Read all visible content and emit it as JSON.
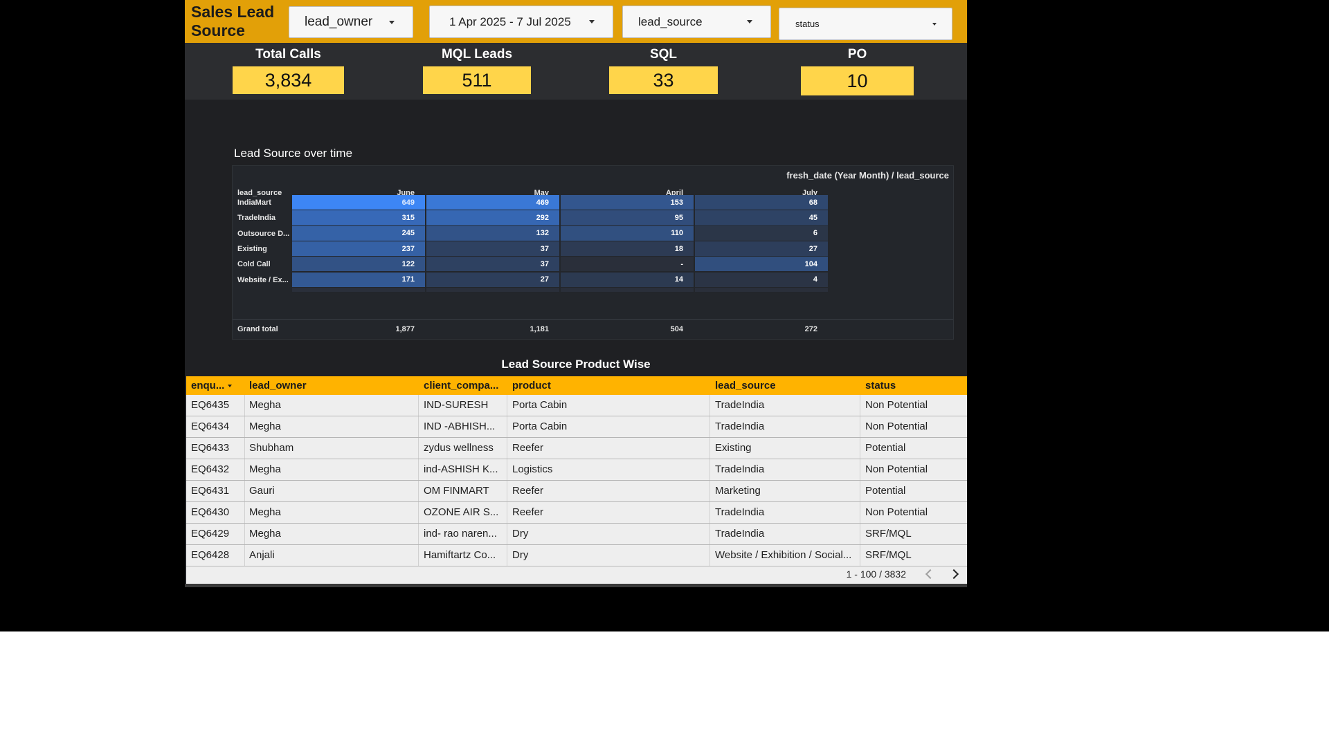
{
  "header": {
    "title": "Sales Lead Source",
    "filters": {
      "lead_owner": "lead_owner",
      "date_range": "1 Apr 2025 - 7 Jul 2025",
      "lead_source": "lead_source",
      "status": "status"
    }
  },
  "kpis": [
    {
      "label": "Total Calls",
      "value": "3,834"
    },
    {
      "label": "MQL Leads",
      "value": "511"
    },
    {
      "label": "SQL",
      "value": "33"
    },
    {
      "label": "PO",
      "value": "10"
    }
  ],
  "pivot": {
    "title": "Lead Source over time",
    "dimension_label": "fresh_date (Year Month) / lead_source",
    "row_header": "lead_source",
    "columns": [
      "June",
      "May",
      "April",
      "July"
    ],
    "rows": [
      {
        "label": "IndiaMart",
        "values": [
          "649",
          "469",
          "153",
          "68"
        ]
      },
      {
        "label": "TradeIndia",
        "values": [
          "315",
          "292",
          "95",
          "45"
        ]
      },
      {
        "label": "Outsource D...",
        "values": [
          "245",
          "132",
          "110",
          "6"
        ]
      },
      {
        "label": "Existing",
        "values": [
          "237",
          "37",
          "18",
          "27"
        ]
      },
      {
        "label": "Cold Call",
        "values": [
          "122",
          "37",
          "-",
          "104"
        ]
      },
      {
        "label": "Website / Ex...",
        "values": [
          "171",
          "27",
          "14",
          "4"
        ]
      }
    ],
    "grand_total": {
      "label": "Grand total",
      "values": [
        "1,877",
        "1,181",
        "504",
        "272"
      ]
    },
    "heat_numbers": [
      [
        649,
        469,
        153,
        68
      ],
      [
        315,
        292,
        95,
        45
      ],
      [
        245,
        132,
        110,
        6
      ],
      [
        237,
        37,
        18,
        27
      ],
      [
        122,
        37,
        0,
        104
      ],
      [
        171,
        27,
        14,
        4
      ]
    ],
    "colors": {
      "high": "#3d86f5",
      "low": "#2a2f3a"
    }
  },
  "table": {
    "title": "Lead Source Product Wise",
    "columns": [
      "enqu...",
      "lead_owner",
      "client_compa...",
      "product",
      "lead_source",
      "status"
    ],
    "rows": [
      [
        "EQ6435",
        "Megha",
        "IND-SURESH",
        "Porta Cabin",
        "TradeIndia",
        "Non Potential"
      ],
      [
        "EQ6434",
        "Megha",
        "IND -ABHISH...",
        "Porta Cabin",
        "TradeIndia",
        "Non Potential"
      ],
      [
        "EQ6433",
        "Shubham",
        "zydus wellness",
        "Reefer",
        "Existing",
        "Potential"
      ],
      [
        "EQ6432",
        "Megha",
        "ind-ASHISH K...",
        "Logistics",
        "TradeIndia",
        "Non Potential"
      ],
      [
        "EQ6431",
        "Gauri",
        "OM FINMART",
        "Reefer",
        "Marketing",
        "Potential"
      ],
      [
        "EQ6430",
        "Megha",
        "OZONE AIR S...",
        "Reefer",
        "TradeIndia",
        "Non Potential"
      ],
      [
        "EQ6429",
        "Megha",
        "ind- rao naren...",
        "Dry",
        "TradeIndia",
        "SRF/MQL"
      ],
      [
        "EQ6428",
        "Anjali",
        "Hamiftartz Co...",
        "Dry",
        "Website / Exhibition / Social...",
        "SRF/MQL"
      ]
    ],
    "pagination": "1 - 100 / 3832"
  }
}
